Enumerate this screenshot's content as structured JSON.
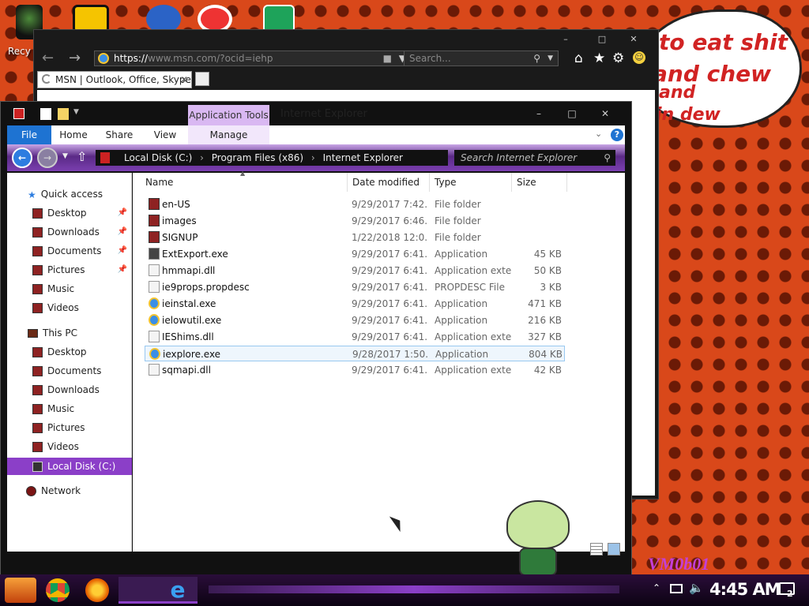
{
  "desktop": {
    "recycle_label": "Recy",
    "bubble_lines": [
      "to eat shit",
      "and chew",
      "and",
      "in dew"
    ],
    "signature": "VM0b01"
  },
  "ie": {
    "address_prefix": "https://",
    "address_host": "www.msn.com",
    "address_rest": "/?ocid=iehp",
    "search_placeholder": "Search...",
    "tab_title": "MSN | Outlook, Office, Skype,...",
    "minimize": "–",
    "maximize": "□",
    "close": "✕"
  },
  "explorer": {
    "context_tab": "Application Tools",
    "window_title": "Internet Explorer",
    "ribbon_tabs": [
      "File",
      "Home",
      "Share",
      "View",
      "Manage"
    ],
    "breadcrumb": [
      "Local Disk (C:)",
      "Program Files (x86)",
      "Internet Explorer"
    ],
    "search_placeholder": "Search Internet Explorer",
    "columns": [
      "Name",
      "Date modified",
      "Type",
      "Size"
    ],
    "nav": {
      "quick_access": "Quick access",
      "quick_items": [
        "Desktop",
        "Downloads",
        "Documents",
        "Pictures",
        "Music",
        "Videos"
      ],
      "this_pc": "This PC",
      "pc_items": [
        "Desktop",
        "Documents",
        "Downloads",
        "Music",
        "Pictures",
        "Videos"
      ],
      "local_disk": "Local Disk (C:)",
      "network": "Network"
    },
    "files": [
      {
        "name": "en-US",
        "date": "9/29/2017 7:42...",
        "type": "File folder",
        "size": ""
      },
      {
        "name": "images",
        "date": "9/29/2017 6:46...",
        "type": "File folder",
        "size": ""
      },
      {
        "name": "SIGNUP",
        "date": "1/22/2018 12:0...",
        "type": "File folder",
        "size": ""
      },
      {
        "name": "ExtExport.exe",
        "date": "9/29/2017 6:41...",
        "type": "Application",
        "size": "45 KB"
      },
      {
        "name": "hmmapi.dll",
        "date": "9/29/2017 6:41...",
        "type": "Application exte...",
        "size": "50 KB"
      },
      {
        "name": "ie9props.propdesc",
        "date": "9/29/2017 6:41...",
        "type": "PROPDESC File",
        "size": "3 KB"
      },
      {
        "name": "ieinstal.exe",
        "date": "9/29/2017 6:41...",
        "type": "Application",
        "size": "471 KB"
      },
      {
        "name": "ielowutil.exe",
        "date": "9/29/2017 6:41...",
        "type": "Application",
        "size": "216 KB"
      },
      {
        "name": "IEShims.dll",
        "date": "9/29/2017 6:41...",
        "type": "Application exte...",
        "size": "327 KB"
      },
      {
        "name": "iexplore.exe",
        "date": "9/28/2017 1:50...",
        "type": "Application",
        "size": "804 KB"
      },
      {
        "name": "sqmapi.dll",
        "date": "9/29/2017 6:41...",
        "type": "Application exte...",
        "size": "42 KB"
      }
    ]
  },
  "taskbar": {
    "time": "4:45 AM",
    "notifications": "2"
  },
  "colors": {
    "accent": "#8b3fc8",
    "context_tab": "#d9b8f2",
    "desktop": "#d9481a"
  }
}
